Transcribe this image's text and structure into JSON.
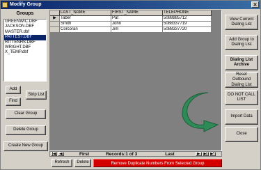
{
  "window": {
    "title": "Modify Group",
    "close_glyph": "✕"
  },
  "groups": {
    "label": "Groups",
    "items": [
      "GREENWIC.DBF",
      "JACKSON.DBF",
      "MASTER.dbf",
      "PATTEST.DBF",
      "RITTENHS.DBF",
      "WRIGHT.DBF",
      "X_TEMP.dbf"
    ],
    "selected_index": 3
  },
  "left_buttons": {
    "add": "Add",
    "find": "Find",
    "strip_list": "Strip List",
    "clear_group": "Clear Group",
    "delete_group": "Delete Group",
    "create_new_group": "Create New Group"
  },
  "table": {
    "columns": [
      "LAST_NAME",
      "FIRST_NAME",
      "TELEPHONE"
    ],
    "current_row_marker": "▶",
    "rows": [
      [
        "Taber",
        "Pat",
        "5088885712"
      ],
      [
        "Smith",
        "John",
        "5088337719"
      ],
      [
        "Corcoran",
        "Jim",
        "5088337720"
      ]
    ]
  },
  "right_buttons": {
    "view_current": "View Current\nDialing List",
    "add_to_archive": "Add Group to\nDialing List",
    "dialing_archive": "Dialing List\nArchive",
    "reset_outbound": "Reset Outbound\nDialing List",
    "do_not_call": "DO NOT CALL\nLIST",
    "import_data": "Import Data",
    "close": "Close"
  },
  "navigator": {
    "first_label": "First",
    "records_label": "Records:1 of 3",
    "last_label": "Last",
    "btn_first": "|◀",
    "btn_prev": "◀",
    "btn_next": "▶",
    "btn_last": "▶|",
    "btn_new": "▶*"
  },
  "bottom": {
    "refresh": "Refresh",
    "delete": "Delete",
    "remove_dupes": "Remove Duplicate Numbers From Selected Group"
  },
  "colors": {
    "accent_arrow": "#2e8b57",
    "danger": "#d40000"
  }
}
